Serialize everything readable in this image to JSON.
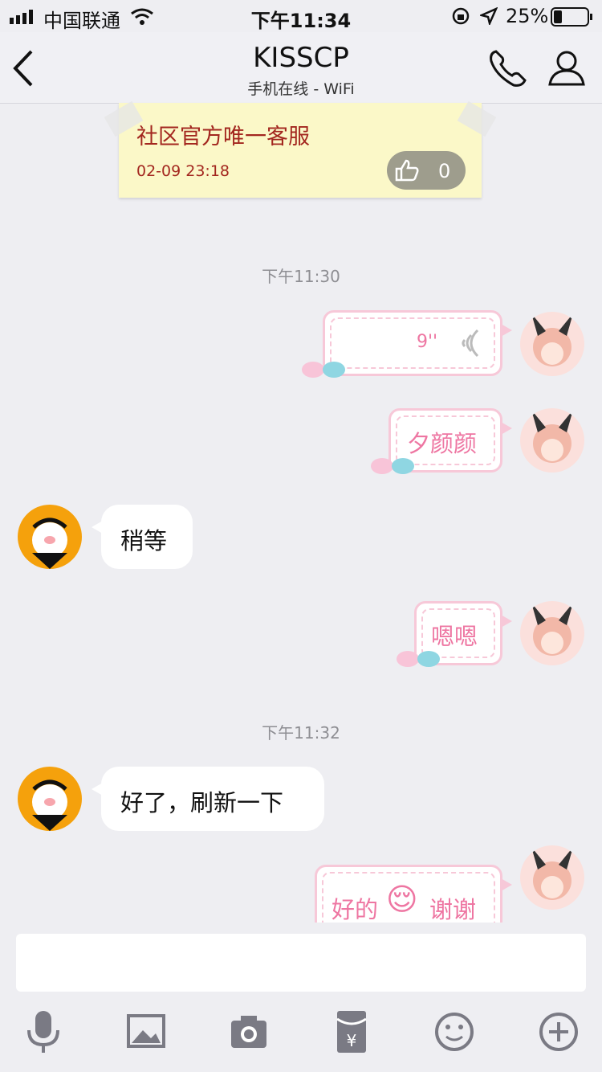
{
  "status_bar": {
    "carrier": "中国联通",
    "time": "下午11:34",
    "battery": "25%"
  },
  "header": {
    "title": "KISSCP",
    "subtitle": "手机在线 - WiFi"
  },
  "note": {
    "title": "社区官方唯一客服",
    "date": "02-09 23:18",
    "likes": "0"
  },
  "timestamps": [
    "下午11:30",
    "下午11:32"
  ],
  "messages": [
    {
      "side": "right",
      "type": "voice",
      "duration": "9''"
    },
    {
      "side": "right",
      "text": "夕颜颜"
    },
    {
      "side": "left",
      "text": "稍等"
    },
    {
      "side": "right",
      "text": "嗯嗯"
    },
    {
      "side": "left",
      "text": "好了，刷新一下"
    },
    {
      "side": "right",
      "text_before": "好的",
      "emoji": "😌",
      "text_after": "谢谢"
    }
  ],
  "toolbar": [
    "microphone-icon",
    "image-icon",
    "camera-icon",
    "red-packet-icon",
    "emoji-icon",
    "plus-icon"
  ],
  "colors": {
    "pink": "#ee76a2",
    "note_red": "#a3271f",
    "note_bg": "#fbf8c8"
  }
}
